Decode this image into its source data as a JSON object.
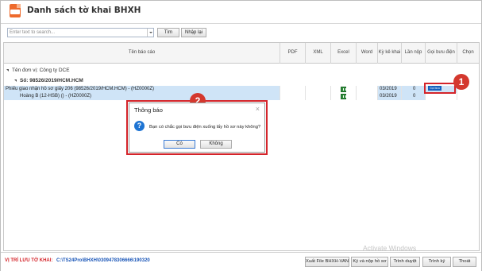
{
  "window": {
    "title": "Danh sách tờ khai BHXH"
  },
  "toolbar": {
    "search_placeholder": "Enter text to search...",
    "search_button": "Tìm",
    "reset_button": "Nhập lại"
  },
  "table": {
    "columns": [
      "Tên báo cáo",
      "PDF",
      "XML",
      "Excel",
      "Word",
      "Kỳ kê khai",
      "Lần nộp",
      "Gọi bưu điện",
      "Chọn"
    ],
    "group_label": "Tên đơn vị: Công ty DCE",
    "subgroup_label": "Số: 98526/2019/HCM.HCM",
    "rows": [
      {
        "name": "Phiếu giao nhận hồ sơ giấy 206 (98526/2019/HCM.HCM) - (HZ0000Z)",
        "period": "03/2019",
        "submission": "0",
        "post_button": "Gọi bưu điện"
      },
      {
        "name": "Hoàng B (12-HSB) () - (HZ0000Z)",
        "period": "03/2019",
        "submission": "0"
      }
    ]
  },
  "dialog": {
    "title": "Thông báo",
    "message": "Bạn có chắc gọi bưu điện xuống lấy hồ sơ này không?",
    "yes_button": "Có",
    "no_button": "Không"
  },
  "callouts": [
    "1",
    "2"
  ],
  "statusbar": {
    "path_label": "VỊ TRÍ LƯU TỜ KHAI:",
    "path_value": "C:\\TS24Pro\\BHXH\\0309478306666\\190320",
    "buttons": [
      "Xuất File BHXH-VAN",
      "Ký và nộp hồ sơ",
      "Trình duyệt",
      "Trình ký",
      "Thoát"
    ]
  },
  "watermark": "Activate Windows",
  "colors": {
    "accent_red": "#d4242a",
    "selection": "#cfe4f7",
    "primary_blue": "#1560bd"
  }
}
